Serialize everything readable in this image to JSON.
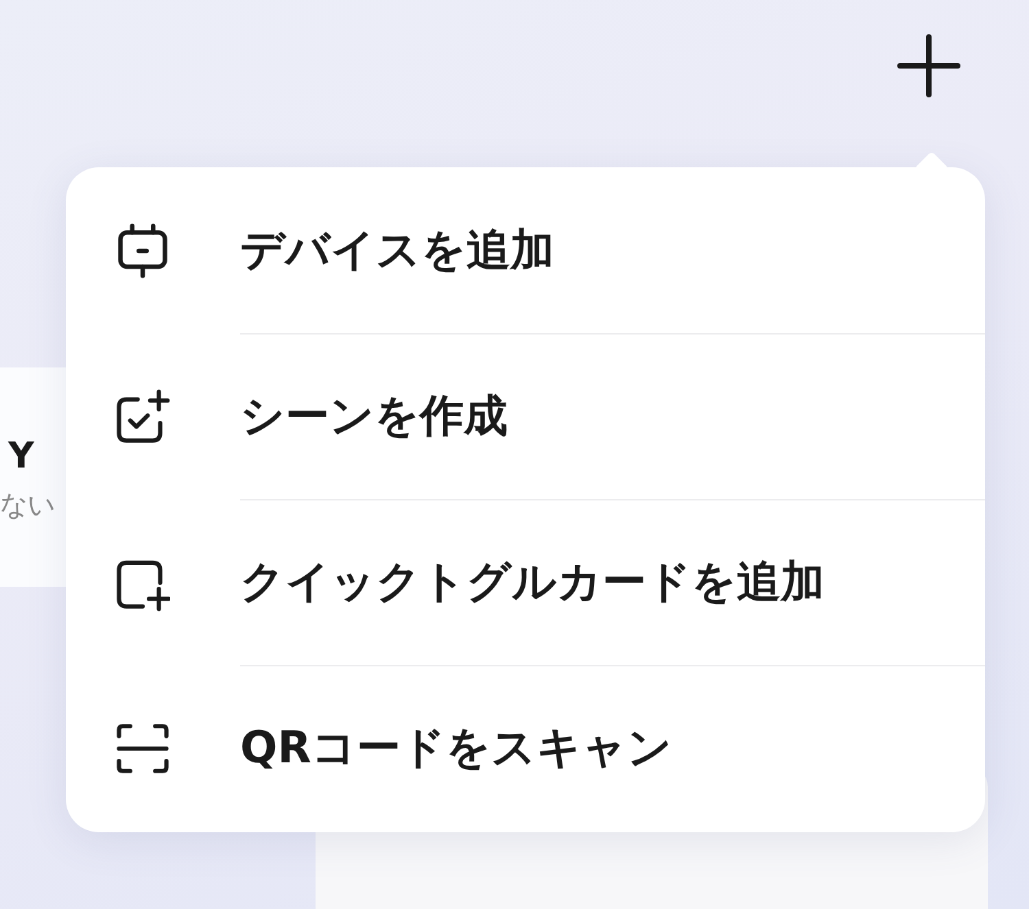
{
  "background": {
    "card_title": "Y",
    "card_subtitle": "ない"
  },
  "menu": {
    "items": [
      {
        "kind": "device",
        "label": "デバイスを追加"
      },
      {
        "kind": "scene",
        "label": "シーンを作成"
      },
      {
        "kind": "card",
        "label": "クイックトグルカードを追加"
      },
      {
        "kind": "qr",
        "label": "QRコードをスキャン"
      }
    ]
  }
}
